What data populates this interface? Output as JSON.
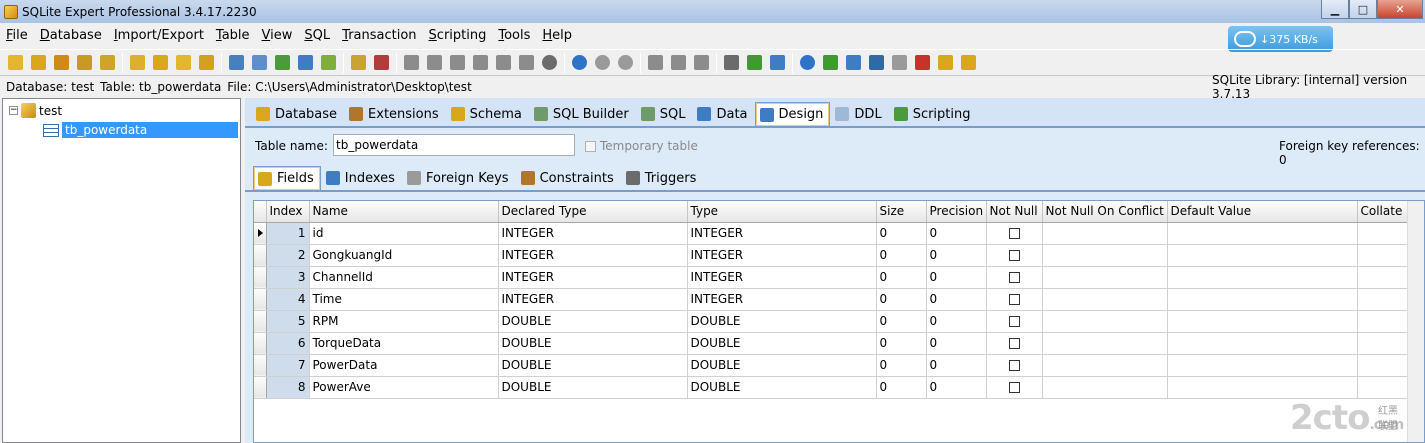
{
  "window": {
    "title": "SQLite Expert Professional 3.4.17.2230"
  },
  "menu": [
    "File",
    "Database",
    "Import/Export",
    "Table",
    "View",
    "SQL",
    "Transaction",
    "Scripting",
    "Tools",
    "Help"
  ],
  "speed_widget": {
    "text": "↓375 KB/s"
  },
  "toolbar_icons": [
    {
      "name": "new-database-icon",
      "color": "#e4b62c"
    },
    {
      "name": "add-database-icon",
      "color": "#d8a71b"
    },
    {
      "name": "remove-database-icon",
      "color": "#d18a1a"
    },
    {
      "name": "database-settings-icon",
      "color": "#c79b23"
    },
    {
      "name": "database-info-icon",
      "color": "#cfa42a"
    },
    {
      "name": "attach-database-icon",
      "color": "#dcb02c"
    },
    {
      "name": "detach-database-icon",
      "color": "#d8a71b"
    },
    {
      "name": "vacuum-icon",
      "color": "#e4b62c"
    },
    {
      "name": "backup-icon",
      "color": "#d1a21e"
    },
    {
      "name": "new-table-icon",
      "color": "#4a7fbf"
    },
    {
      "name": "design-table-icon",
      "color": "#5f8fc9"
    },
    {
      "name": "refresh-table-icon",
      "color": "#4b9a3b"
    },
    {
      "name": "rename-table-icon",
      "color": "#3f7cc4"
    },
    {
      "name": "drop-table-icon",
      "color": "#7fae3f"
    },
    {
      "name": "import-icon",
      "color": "#c9a432"
    },
    {
      "name": "export-icon",
      "color": "#b23b3b"
    },
    {
      "name": "script-run-icon",
      "color": "#8c8c8c"
    },
    {
      "name": "script-step-icon",
      "color": "#8c8c8c"
    },
    {
      "name": "script-new-icon",
      "color": "#8c8c8c"
    },
    {
      "name": "script-open-icon",
      "color": "#8c8c8c"
    },
    {
      "name": "script-save-icon",
      "color": "#8c8c8c"
    },
    {
      "name": "script-debug-icon",
      "color": "#8c8c8c"
    },
    {
      "name": "script-stop-icon",
      "color": "#6b6b6b"
    },
    {
      "name": "play-icon",
      "color": "#2f73c8"
    },
    {
      "name": "pause-icon",
      "color": "#9a9a9a"
    },
    {
      "name": "stop-icon",
      "color": "#9a9a9a"
    },
    {
      "name": "trigger-new-icon",
      "color": "#8c8c8c"
    },
    {
      "name": "trigger-edit-icon",
      "color": "#8c8c8c"
    },
    {
      "name": "trigger-drop-icon",
      "color": "#8c8c8c"
    },
    {
      "name": "settings-icon",
      "color": "#6b6b6b"
    },
    {
      "name": "filter-icon",
      "color": "#3f9b2f"
    },
    {
      "name": "grid-view-icon",
      "color": "#3f7cc4"
    },
    {
      "name": "help-icon",
      "color": "#2f73c8"
    },
    {
      "name": "web-icon",
      "color": "#3f9b2f"
    },
    {
      "name": "update-icon",
      "color": "#3f7cc4"
    },
    {
      "name": "pen-icon",
      "color": "#2f6aa5"
    },
    {
      "name": "mail-icon",
      "color": "#9a9a9a"
    },
    {
      "name": "exit-icon",
      "color": "#c8322a"
    },
    {
      "name": "plugin-icon",
      "color": "#d8a71b"
    },
    {
      "name": "register-icon",
      "color": "#d8a71b"
    }
  ],
  "info": {
    "database": "Database: test",
    "table": "Table: tb_powerdata",
    "file": "File: C:\\Users\\Administrator\\Desktop\\test",
    "library": "SQLite Library: [internal] version 3.7.13"
  },
  "tree": {
    "database": "test",
    "table": "tb_powerdata",
    "expander": "−"
  },
  "main_tabs": [
    {
      "label": "Database",
      "color": "#d8a71b"
    },
    {
      "label": "Extensions",
      "color": "#b0762e"
    },
    {
      "label": "Schema",
      "color": "#d8a71b"
    },
    {
      "label": "SQL Builder",
      "color": "#6f9a6a"
    },
    {
      "label": "SQL",
      "color": "#6f9a6a"
    },
    {
      "label": "Data",
      "color": "#3f7cc4"
    },
    {
      "label": "Design",
      "color": "#3f7cc4",
      "active": true
    },
    {
      "label": "DDL",
      "color": "#9fb8d8"
    },
    {
      "label": "Scripting",
      "color": "#4b9a3b"
    }
  ],
  "design": {
    "table_name_label": "Table name:",
    "table_name_value": "tb_powerdata",
    "temporary_label": "Temporary table",
    "fk_label": "Foreign key references: 0"
  },
  "sub_tabs": [
    {
      "label": "Fields",
      "color": "#d8a71b",
      "active": true
    },
    {
      "label": "Indexes",
      "color": "#3f7cc4"
    },
    {
      "label": "Foreign Keys",
      "color": "#9a9a9a"
    },
    {
      "label": "Constraints",
      "color": "#b0762e"
    },
    {
      "label": "Triggers",
      "color": "#6b6b6b"
    }
  ],
  "grid": {
    "columns": [
      "Index",
      "Name",
      "Declared Type",
      "Type",
      "Size",
      "Precision",
      "Not Null",
      "Not Null On Conflict",
      "Default Value",
      "Collate"
    ],
    "rows": [
      {
        "index": "1",
        "name": "id",
        "declared": "INTEGER",
        "type": "INTEGER",
        "size": "0",
        "precision": "0"
      },
      {
        "index": "2",
        "name": "GongkuangId",
        "declared": "INTEGER",
        "type": "INTEGER",
        "size": "0",
        "precision": "0"
      },
      {
        "index": "3",
        "name": "ChannelId",
        "declared": "INTEGER",
        "type": "INTEGER",
        "size": "0",
        "precision": "0"
      },
      {
        "index": "4",
        "name": "Time",
        "declared": "INTEGER",
        "type": "INTEGER",
        "size": "0",
        "precision": "0"
      },
      {
        "index": "5",
        "name": "RPM",
        "declared": "DOUBLE",
        "type": "DOUBLE",
        "size": "0",
        "precision": "0"
      },
      {
        "index": "6",
        "name": "TorqueData",
        "declared": "DOUBLE",
        "type": "DOUBLE",
        "size": "0",
        "precision": "0"
      },
      {
        "index": "7",
        "name": "PowerData",
        "declared": "DOUBLE",
        "type": "DOUBLE",
        "size": "0",
        "precision": "0"
      },
      {
        "index": "8",
        "name": "PowerAve",
        "declared": "DOUBLE",
        "type": "DOUBLE",
        "size": "0",
        "precision": "0"
      }
    ]
  },
  "watermark": {
    "text": "2cto",
    "sub": "红黑联盟",
    "suffix": ".com"
  }
}
